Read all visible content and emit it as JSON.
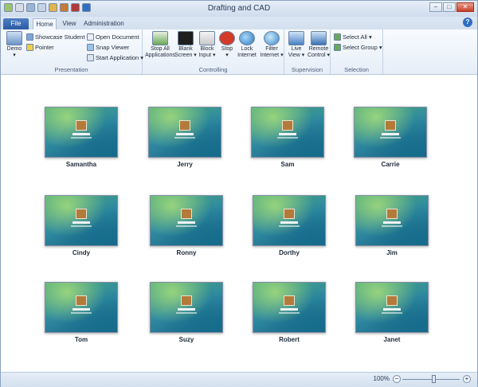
{
  "window": {
    "title": "Drafting and CAD"
  },
  "tabs": {
    "file": "File",
    "home": "Home",
    "view": "View",
    "administration": "Administration"
  },
  "ribbon": {
    "presentation": {
      "label": "Presentation",
      "demo": "Demo",
      "showcase_student": "Showcase Student",
      "pointer": "Pointer",
      "open_document": "Open Document",
      "snap_viewer": "Snap Viewer",
      "start_application": "Start Application"
    },
    "controlling": {
      "label": "Controlling",
      "stop_all_applications_1": "Stop All",
      "stop_all_applications_2": "Applications",
      "blank_screen_1": "Blank",
      "blank_screen_2": "Screen",
      "block_input_1": "Block",
      "block_input_2": "Input",
      "stop": "Stop",
      "lock_internet_1": "Lock",
      "lock_internet_2": "Internet",
      "filter_internet_1": "Filter",
      "filter_internet_2": "Internet"
    },
    "supervision": {
      "label": "Supervision",
      "live_view_1": "Live",
      "live_view_2": "View",
      "remote_control_1": "Remote",
      "remote_control_2": "Control"
    },
    "selection": {
      "label": "Selection",
      "select_all": "Select All",
      "select_group": "Select Group"
    }
  },
  "students": [
    "Samantha",
    "Jerry",
    "Sam",
    "Carrie",
    "Cindy",
    "Ronny",
    "Dorthy",
    "Jim",
    "Tom",
    "Suzy",
    "Robert",
    "Janet"
  ],
  "status": {
    "zoom": "100%"
  },
  "colors": {
    "accent": "#2a5ba4",
    "ribbon_bg": "#e6eef8",
    "close": "#c8402a"
  }
}
